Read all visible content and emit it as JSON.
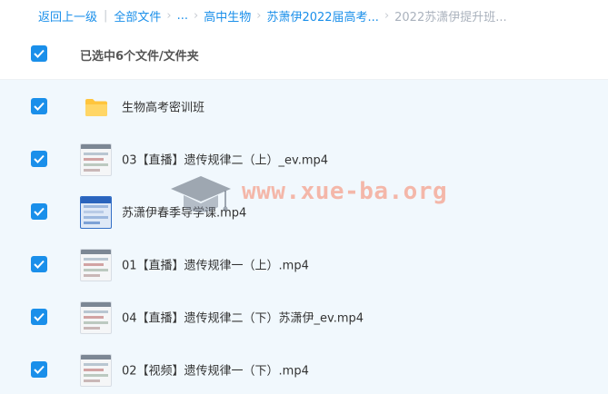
{
  "breadcrumb": {
    "back": "返回上一级",
    "all_files": "全部文件",
    "ellipsis": "...",
    "level1": "高中生物",
    "level2": "苏萧伊2022届高考...",
    "current": "2022苏潇伊提升班..."
  },
  "header": {
    "selected_text": "已选中6个文件/文件夹"
  },
  "files": [
    {
      "name": "生物高考密训班",
      "type": "folder"
    },
    {
      "name": "03【直播】遗传规律二（上）_ev.mp4",
      "type": "video"
    },
    {
      "name": "苏潇伊春季导学课.mp4",
      "type": "video"
    },
    {
      "name": "01【直播】遗传规律一（上）.mp4",
      "type": "video"
    },
    {
      "name": "04【直播】遗传规律二（下）苏潇伊_ev.mp4",
      "type": "video"
    },
    {
      "name": "02【视频】遗传规律一（下）.mp4",
      "type": "video"
    }
  ],
  "watermark": {
    "text": "www.xue-ba.org",
    "icon": "graduation-cap-icon"
  },
  "colors": {
    "accent": "#1a8fea",
    "list_bg": "#f1f8fd",
    "folder": "#ffc53d"
  }
}
